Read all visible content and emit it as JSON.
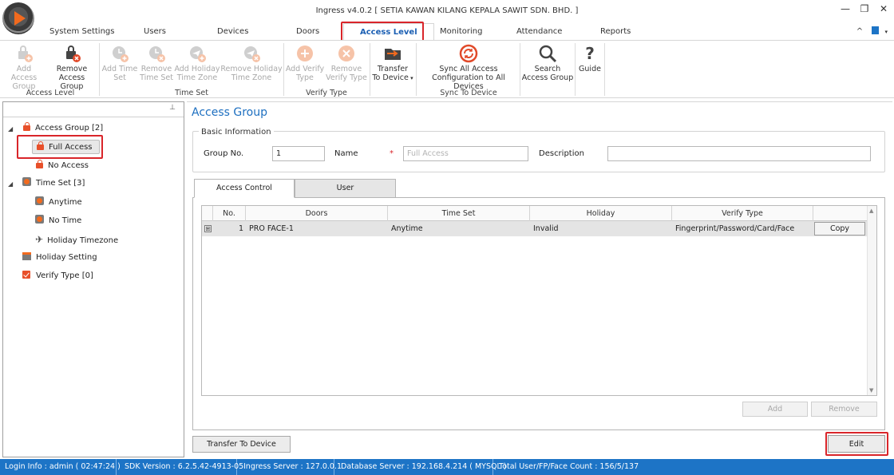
{
  "window": {
    "title": "Ingress v4.0.2 [ SETIA KAWAN KILANG KEPALA SAWIT SDN. BHD. ]",
    "minimize": "—",
    "restore": "❐",
    "close": "✕"
  },
  "menu": {
    "tabs": [
      "System Settings",
      "Users",
      "Devices",
      "Doors",
      "Access Level",
      "Monitoring",
      "Attendance",
      "Reports"
    ],
    "active": "Access Level",
    "nav_right": "^"
  },
  "ribbon": {
    "access_level": {
      "label": "Access Level",
      "add_access_group": [
        "Add Access",
        "Group"
      ],
      "remove_access_group": [
        "Remove",
        "Access Group"
      ]
    },
    "time_set": {
      "label": "Time Set",
      "add_time_set": [
        "Add Time",
        "Set"
      ],
      "remove_time_set": [
        "Remove",
        "Time Set"
      ],
      "add_holiday_time_zone": [
        "Add Holiday",
        "Time Zone"
      ],
      "remove_holiday_time_zone": [
        "Remove Holiday",
        "Time Zone"
      ]
    },
    "verify_type": {
      "label": "Verify Type",
      "add_verify_type": [
        "Add Verify",
        "Type"
      ],
      "remove_verify_type": [
        "Remove",
        "Verify Type"
      ]
    },
    "transfer_to_device": [
      "Transfer",
      "To Device"
    ],
    "sync_to_device": {
      "label": "Sync To Device",
      "sync_all": [
        "Sync All Access",
        "Configuration to All Devices"
      ]
    },
    "search_access_group": [
      "Search",
      "Access Group"
    ],
    "guide": "Guide"
  },
  "tree": {
    "pin": "⊥",
    "access_group": "Access Group [2]",
    "full_access": "Full Access",
    "no_access": "No Access",
    "time_set": "Time Set [3]",
    "anytime": "Anytime",
    "no_time": "No Time",
    "holiday_timezone": "Holiday Timezone",
    "holiday_setting": "Holiday Setting",
    "verify_type": "Verify Type [0]"
  },
  "main": {
    "title": "Access Group",
    "basic_info": {
      "legend": "Basic Information",
      "group_no_label": "Group No.",
      "group_no_value": "1",
      "name_label": "Name",
      "required_mark": "*",
      "name_placeholder": "Full Access",
      "description_label": "Description",
      "description_value": ""
    },
    "tabs": [
      "Access Control",
      "User"
    ],
    "grid": {
      "columns": [
        "No.",
        "Doors",
        "Time Set",
        "Holiday",
        "Verify Type"
      ],
      "rows": [
        {
          "no": "1",
          "door": "PRO FACE-1",
          "time_set": "Anytime",
          "holiday": "Invalid",
          "verify_type": "Fingerprint/Password/Card/Face",
          "action": "Copy",
          "expander": "⊞"
        }
      ]
    },
    "add_button": "Add",
    "remove_button": "Remove",
    "transfer_button": "Transfer To Device",
    "edit_button": "Edit"
  },
  "status_bar": {
    "login": "Login Info : admin ( 02:47:24 )",
    "sdk": "SDK Version : 6.2.5.42-4913-05",
    "ingress_server": "Ingress Server : 127.0.0.1",
    "database_server": "Database Server : 192.168.4.214 ( MYSQL )",
    "counts": "Total User/FP/Face Count : 156/5/137"
  },
  "colors": {
    "accent": "#1d74c6",
    "highlight": "#d9252a",
    "icon_orange": "#f26a1e"
  }
}
